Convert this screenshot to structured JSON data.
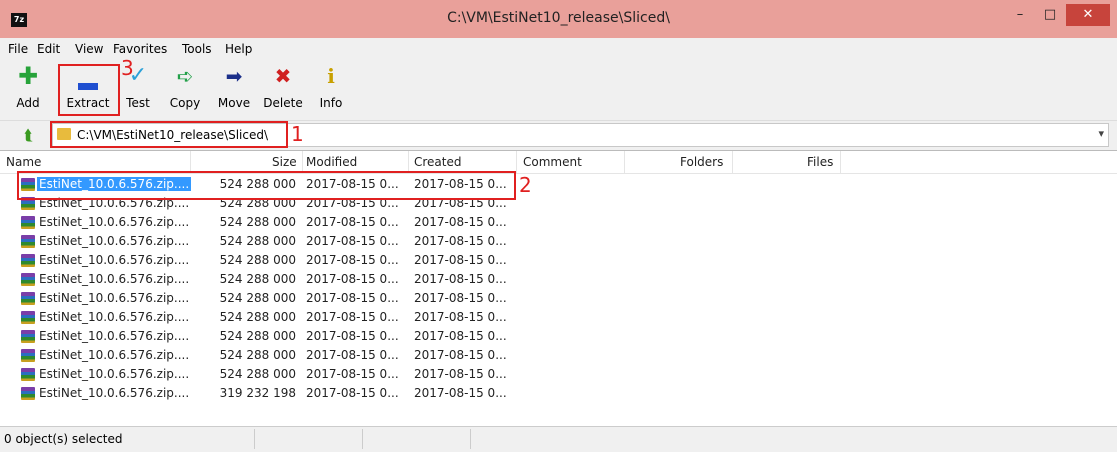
{
  "window": {
    "title": "C:\\VM\\EstiNet10_release\\Sliced\\",
    "app_icon": "7z-icon"
  },
  "menu": [
    "File",
    "Edit",
    "View",
    "Favorites",
    "Tools",
    "Help"
  ],
  "toolbar": [
    {
      "label": "Add",
      "icon": "plus-icon",
      "color": "#27a33a"
    },
    {
      "label": "Extract",
      "icon": "minus-icon",
      "color": "#1f4fd0"
    },
    {
      "label": "Test",
      "icon": "check-icon",
      "color": "#2aa0d8"
    },
    {
      "label": "Copy",
      "icon": "copy-arrow-icon",
      "color": "#23a04a"
    },
    {
      "label": "Move",
      "icon": "move-arrow-icon",
      "color": "#1b2f8a"
    },
    {
      "label": "Delete",
      "icon": "x-icon",
      "color": "#d02020"
    },
    {
      "label": "Info",
      "icon": "info-icon",
      "color": "#c8a000"
    }
  ],
  "address": {
    "path": "C:\\VM\\EstiNet10_release\\Sliced\\"
  },
  "columns": [
    "Name",
    "Size",
    "Modified",
    "Created",
    "Comment",
    "Folders",
    "Files"
  ],
  "rows": [
    {
      "name": "EstiNet_10.0.6.576.zip....",
      "size": "524 288 000",
      "modified": "2017-08-15 0...",
      "created": "2017-08-15 0..."
    },
    {
      "name": "EstiNet_10.0.6.576.zip....",
      "size": "524 288 000",
      "modified": "2017-08-15 0...",
      "created": "2017-08-15 0..."
    },
    {
      "name": "EstiNet_10.0.6.576.zip....",
      "size": "524 288 000",
      "modified": "2017-08-15 0...",
      "created": "2017-08-15 0..."
    },
    {
      "name": "EstiNet_10.0.6.576.zip....",
      "size": "524 288 000",
      "modified": "2017-08-15 0...",
      "created": "2017-08-15 0..."
    },
    {
      "name": "EstiNet_10.0.6.576.zip....",
      "size": "524 288 000",
      "modified": "2017-08-15 0...",
      "created": "2017-08-15 0..."
    },
    {
      "name": "EstiNet_10.0.6.576.zip....",
      "size": "524 288 000",
      "modified": "2017-08-15 0...",
      "created": "2017-08-15 0..."
    },
    {
      "name": "EstiNet_10.0.6.576.zip....",
      "size": "524 288 000",
      "modified": "2017-08-15 0...",
      "created": "2017-08-15 0..."
    },
    {
      "name": "EstiNet_10.0.6.576.zip....",
      "size": "524 288 000",
      "modified": "2017-08-15 0...",
      "created": "2017-08-15 0..."
    },
    {
      "name": "EstiNet_10.0.6.576.zip....",
      "size": "524 288 000",
      "modified": "2017-08-15 0...",
      "created": "2017-08-15 0..."
    },
    {
      "name": "EstiNet_10.0.6.576.zip....",
      "size": "524 288 000",
      "modified": "2017-08-15 0...",
      "created": "2017-08-15 0..."
    },
    {
      "name": "EstiNet_10.0.6.576.zip....",
      "size": "524 288 000",
      "modified": "2017-08-15 0...",
      "created": "2017-08-15 0..."
    },
    {
      "name": "EstiNet_10.0.6.576.zip....",
      "size": "319 232 198",
      "modified": "2017-08-15 0...",
      "created": "2017-08-15 0..."
    }
  ],
  "selected_row": 0,
  "status": "0 object(s) selected",
  "annotations": [
    "1",
    "2",
    "3"
  ],
  "colors": {
    "titlebar": "#e9a09a",
    "close": "#c7443c",
    "selection": "#3399ff",
    "annotation": "#e02020"
  }
}
